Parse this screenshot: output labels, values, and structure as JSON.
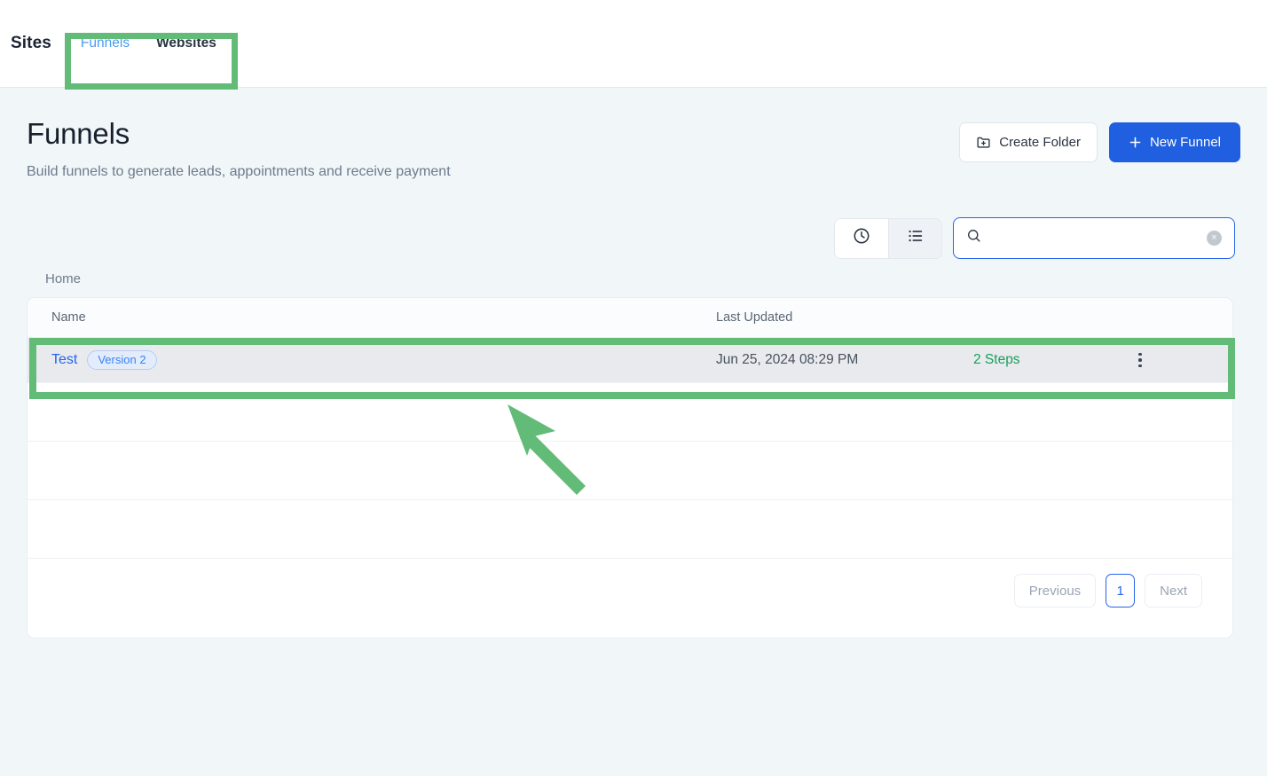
{
  "header": {
    "app_title": "Sites",
    "tabs": [
      {
        "label": "Funnels",
        "active": true
      },
      {
        "label": "Websites",
        "active": false
      }
    ]
  },
  "page": {
    "title": "Funnels",
    "subtitle": "Build funnels to generate leads, appointments and receive payment",
    "create_folder_label": "Create Folder",
    "new_funnel_label": "New Funnel",
    "create_folder_icon": "folder-plus-icon",
    "new_funnel_icon": "plus-icon"
  },
  "toolbar": {
    "recent_icon": "clock-icon",
    "list_icon": "list-icon",
    "search_icon": "search-icon",
    "search_value": "",
    "search_placeholder": "",
    "clear_label": "×"
  },
  "breadcrumb": {
    "current": "Home"
  },
  "table": {
    "columns": [
      "Name",
      "Last Updated"
    ],
    "rows": [
      {
        "name": "Test",
        "badge": "Version 2",
        "last_updated": "Jun 25, 2024 08:29 PM",
        "steps": "2 Steps",
        "menu_icon": "kebab-menu-icon"
      }
    ]
  },
  "pagination": {
    "previous": "Previous",
    "current_page": "1",
    "next": "Next"
  },
  "annotations": {
    "highlight_color": "#63bb78",
    "arrow_color": "#63bb78"
  }
}
